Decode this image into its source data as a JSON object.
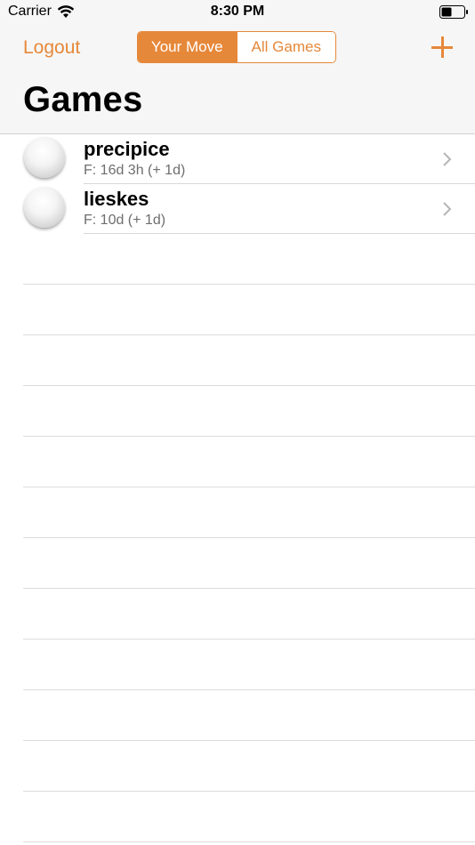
{
  "status_bar": {
    "carrier": "Carrier",
    "time": "8:30 PM",
    "wifi_icon": "wifi-icon",
    "battery_icon": "battery-icon"
  },
  "nav": {
    "logout_label": "Logout",
    "segments": [
      {
        "label": "Your Move",
        "selected": true
      },
      {
        "label": "All Games",
        "selected": false
      }
    ],
    "add_icon": "plus-icon",
    "title": "Games"
  },
  "games": [
    {
      "name": "precipice",
      "detail": "F: 16d 3h (+ 1d)"
    },
    {
      "name": "lieskes",
      "detail": "F: 10d (+ 1d)"
    }
  ],
  "colors": {
    "accent": "#e6883a",
    "navbar_bg": "#f6f6f6",
    "subtitle": "#6e6e6e"
  }
}
